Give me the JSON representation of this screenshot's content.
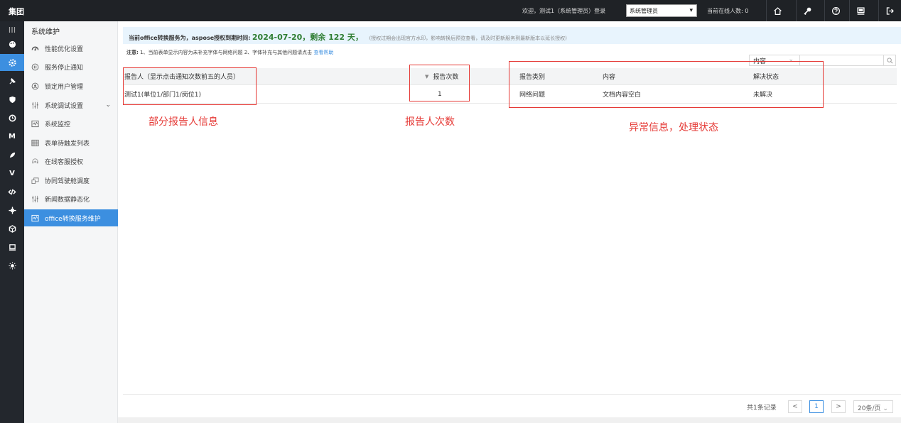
{
  "app": {
    "brand": "集团"
  },
  "topbar": {
    "welcome": "欢迎，测试1（系统管理员）登录",
    "role_select": "系统管理员",
    "online_count": "当前在线人数: 0",
    "icons": [
      "home-icon",
      "key-icon",
      "help-icon",
      "monitor-icon",
      "logout-icon"
    ]
  },
  "rail": {
    "icons": [
      "menu-toggle-icon",
      "palette-icon",
      "settings-icon",
      "pin-icon",
      "shield-icon",
      "clock-icon",
      "m-icon",
      "chart-icon",
      "v-icon",
      "code-icon",
      "plugin-icon",
      "cube-icon",
      "laptop-icon",
      "bulb-icon"
    ],
    "letters": {
      "m": "M",
      "v": "V"
    }
  },
  "sidebar": {
    "title": "系统维护",
    "items": [
      {
        "label": "性能优化设置",
        "icon": "gauge-icon"
      },
      {
        "label": "服务停止通知",
        "icon": "pause-icon"
      },
      {
        "label": "锁定用户管理",
        "icon": "lock-user-icon"
      },
      {
        "label": "系统调试设置",
        "icon": "sliders-icon"
      },
      {
        "label": "系统监控",
        "icon": "monitor-chart-icon"
      },
      {
        "label": "表单待触发列表",
        "icon": "table-icon"
      },
      {
        "label": "在线客服授权",
        "icon": "support-icon"
      },
      {
        "label": "协同驾驶舱调度",
        "icon": "dashboard-icon"
      },
      {
        "label": "新闻数据静态化",
        "icon": "sliders-icon"
      },
      {
        "label": "office转换服务维护",
        "icon": "monitor-chart-icon"
      }
    ],
    "active_index": 9
  },
  "notice": {
    "prefix": "当前office转换服务为，aspose授权到期时间:",
    "date": "2024-07-20，剩余 122 天，",
    "hint": "(授权过期会出现官方水印，影响转换后预览查看，请及时更新服务到最新版本以延长授权)"
  },
  "note": {
    "label": "注意:",
    "text": "1、当前表单显示内容为未补充字体与网络问题 2、字体补充与其他问题请点击",
    "link": "查看帮助"
  },
  "filter": {
    "select_value": "内容",
    "input_value": ""
  },
  "table": {
    "columns": {
      "reporter": "报告人（显示点击通知次数前五的人员）",
      "count": "报告次数",
      "category": "报告类别",
      "content": "内容",
      "status": "解决状态"
    },
    "rows": [
      {
        "reporter": "测试1(单位1/部门1/岗位1)",
        "count": "1",
        "category": "网络问题",
        "content": "文档内容空白",
        "status": "未解决"
      }
    ]
  },
  "annotations": {
    "reporter": "部分报告人信息",
    "count": "报告人次数",
    "exception": "异常信息，处理状态",
    "color": "#e53935"
  },
  "pagination": {
    "total": "共1条记录",
    "current_page": "1",
    "page_size": "20条/页",
    "prev": "<",
    "next": ">"
  },
  "colors": {
    "accent": "#3c8fe0",
    "topbar": "#1f2226",
    "rail": "#23272d"
  }
}
